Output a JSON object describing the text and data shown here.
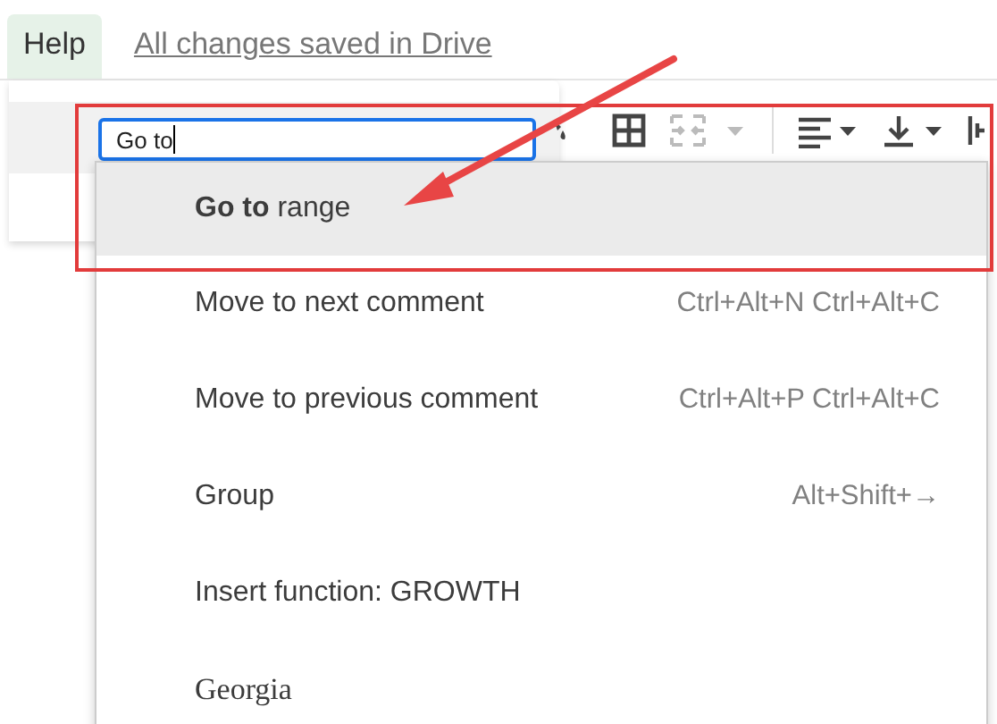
{
  "menubar": {
    "menu": {
      "label": "Help",
      "selected": true
    },
    "save_status": "All changes saved in Drive"
  },
  "search": {
    "value": "Go to"
  },
  "suggestions": [
    {
      "kind": "action",
      "label": "**Go to** range",
      "selected": true
    },
    {
      "kind": "action",
      "label": "Move to next comment",
      "shortcut": "Ctrl+Alt+N Ctrl+Alt+C",
      "selected": false
    },
    {
      "kind": "action",
      "label": "Move to previous comment",
      "shortcut": "Ctrl+Alt+P Ctrl+Alt+C",
      "selected": false
    },
    {
      "kind": "action",
      "label": "Group",
      "shortcut": "Alt+Shift+→",
      "selected": false
    },
    {
      "kind": "action",
      "label": "Insert function: GROWTH",
      "selected": false
    },
    {
      "kind": "font",
      "label": "Georgia",
      "selected": false
    }
  ]
}
